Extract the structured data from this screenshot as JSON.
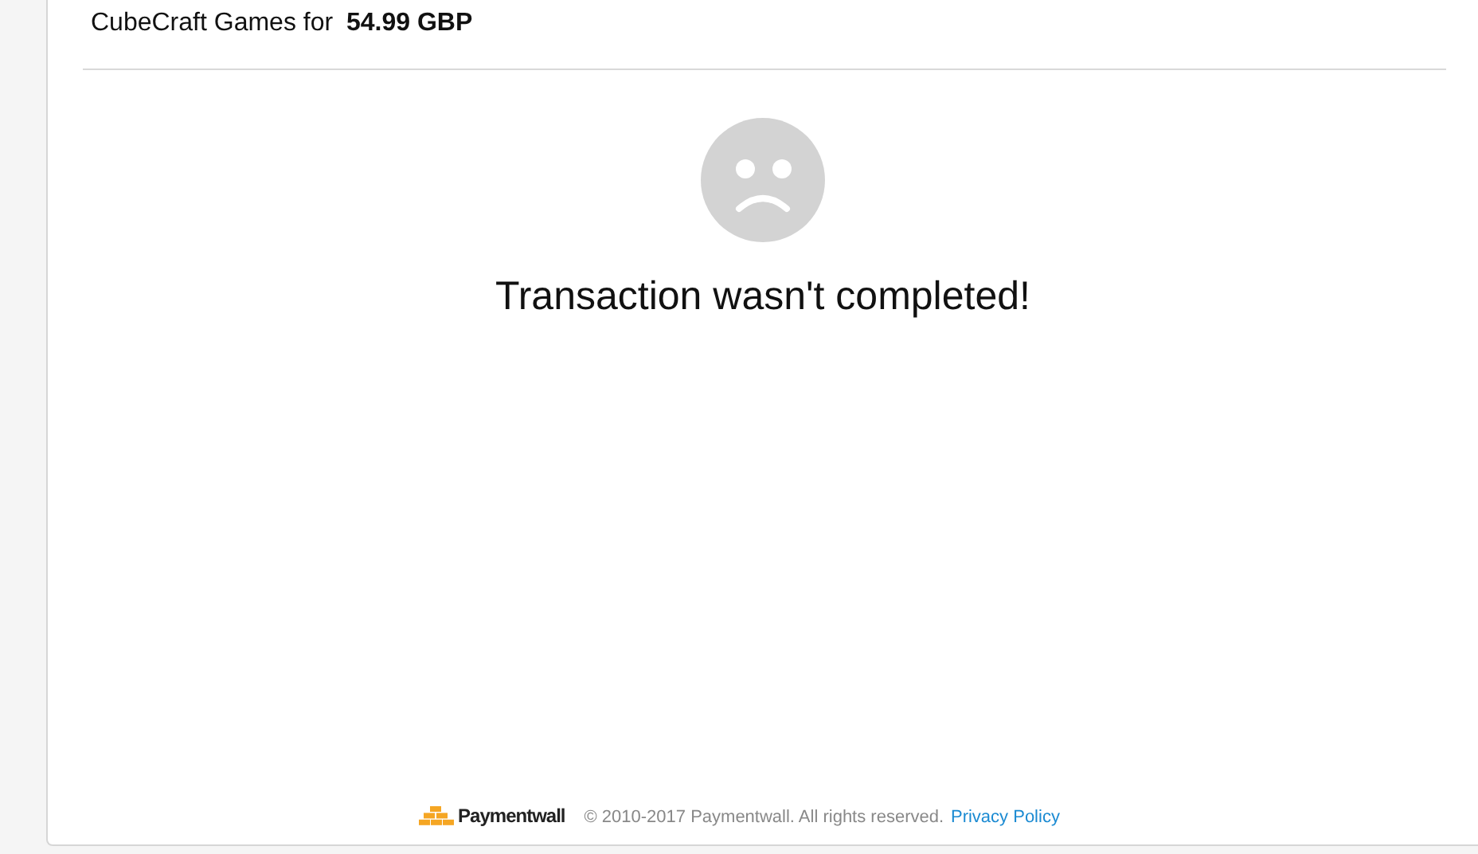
{
  "header": {
    "text": "CubeCraft Games for **54.99 GBP**"
  },
  "status": {
    "message": "Transaction wasn't completed!"
  },
  "footer": {
    "logo_text": "Paymentwall",
    "copyright": "© 2010-2017 Paymentwall. All rights reserved.",
    "link": "Privacy Policy"
  }
}
